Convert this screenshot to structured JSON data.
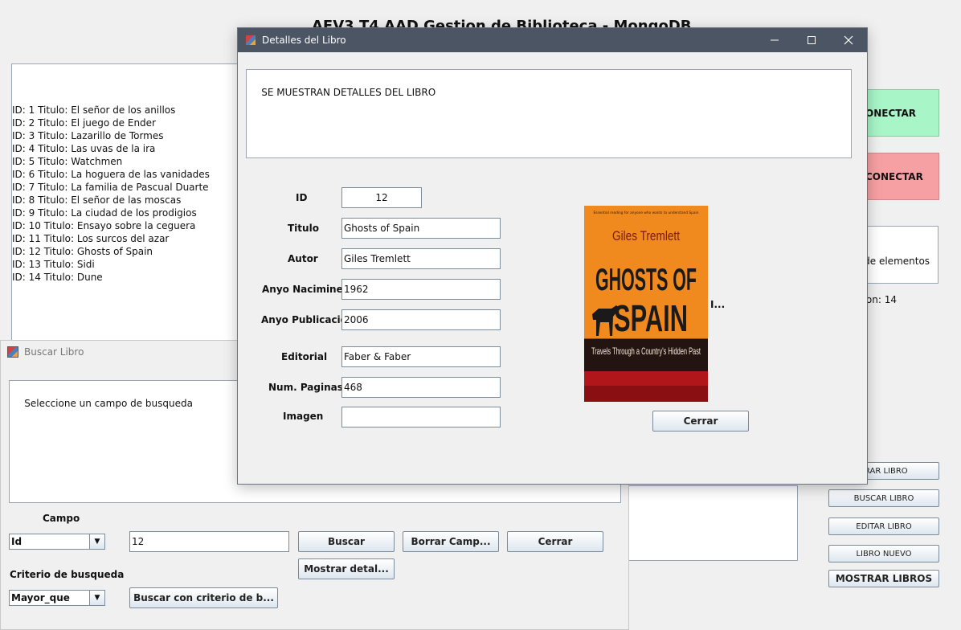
{
  "main": {
    "title": "AEV3 T4 AAD Gestion de Biblioteca - MongoDB",
    "books": [
      "ID: 1 Titulo: El señor de los anillos",
      "ID: 2 Titulo: El juego de Ender",
      "ID: 3 Titulo: Lazarillo de Tormes",
      "ID: 4 Titulo: Las uvas de la ira",
      "ID: 5 Titulo: Watchmen",
      "ID: 6 Titulo: La hoguera de las vanidades",
      "ID: 7 Titulo: La familia de Pascual Duarte",
      "ID: 8 Titulo: El señor de las moscas",
      "ID: 9 Titulo: La ciudad de los prodigios",
      "ID: 10 Titulo: Ensayo sobre la ceguera",
      "ID: 11 Titulo: Los surcos del azar",
      "ID: 12 Titulo: Ghosts of Spain",
      "ID: 13 Titulo: Sidi",
      "ID: 14 Titulo: Dune"
    ],
    "connect_label": "ONECTAR",
    "disconnect_label": "CONECTAR",
    "info_line1": "l de elementos",
    "info_line2": "cion: 14",
    "btn_borrar": "RRAR LIBRO",
    "btn_buscar": "BUSCAR LIBRO",
    "btn_editar": "EDITAR LIBRO",
    "btn_nuevo": "LIBRO NUEVO",
    "btn_mostrar": "MOSTRAR LIBROS",
    "colors": {
      "connect": "#a8f5c8",
      "disconnect": "#f7a0a3"
    }
  },
  "buscar": {
    "title": "Buscar Libro",
    "output": "Seleccione un campo de busqueda",
    "campo_label": "Campo",
    "campo_value": "Id",
    "search_value": "12",
    "btn_buscar": "Buscar",
    "btn_borrar": "Borrar Camp...",
    "btn_cerrar": "Cerrar",
    "btn_mostrar": "Mostrar detal...",
    "criterio_label": "Criterio de busqueda",
    "criterio_value": "Mayor_que",
    "btn_criterio": "Buscar con criterio de b..."
  },
  "detalles": {
    "title": "Detalles del Libro",
    "message": "SE MUESTRAN DETALLES DEL LIBRO",
    "labels": {
      "id": "ID",
      "titulo": "Titulo",
      "autor": "Autor",
      "nacimiento": "Anyo Nacimineto",
      "publicacion": "Anyo Publicacion",
      "editorial": "Editorial",
      "paginas": "Num. Paginas",
      "imagen": "Imagen"
    },
    "values": {
      "id": "12",
      "titulo": "Ghosts of Spain",
      "autor": "Giles Tremlett",
      "nacimiento": "1962",
      "publicacion": "2006",
      "editorial": "Faber & Faber",
      "paginas": "468",
      "imagen": ""
    },
    "cover": {
      "tagline": "Essential reading for anyone who wants to understand Spain",
      "author": "Giles Tremlett",
      "title1": "GHOSTS OF",
      "title2": "SPAIN",
      "subtitle": "Travels Through a Country's Hidden Past",
      "color": "#f08a1e"
    },
    "cover_label": "I...",
    "btn_cerrar": "Cerrar"
  }
}
